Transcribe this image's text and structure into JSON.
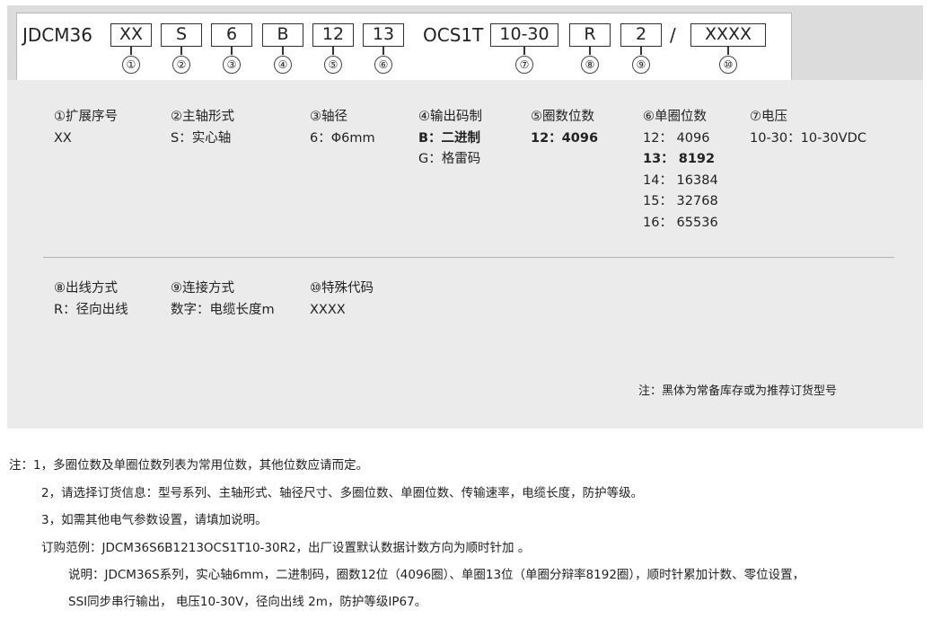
{
  "code": {
    "prefix": "JDCM36",
    "middle": "OCS1T",
    "slash": "/",
    "segments": [
      {
        "label": "XX",
        "num": "①"
      },
      {
        "label": "S",
        "num": "②"
      },
      {
        "label": "6",
        "num": "③"
      },
      {
        "label": "B",
        "num": "④"
      },
      {
        "label": "12",
        "num": "⑤"
      },
      {
        "label": "13",
        "num": "⑥"
      },
      {
        "label": "10-30",
        "num": "⑦"
      },
      {
        "label": "R",
        "num": "⑧"
      },
      {
        "label": "2",
        "num": "⑨"
      },
      {
        "label": "XXXX",
        "num": "⑩"
      }
    ]
  },
  "fields_row1": [
    {
      "header": "①扩展序号",
      "values": [
        {
          "text": "XX",
          "bold": false
        }
      ]
    },
    {
      "header": "②主轴形式",
      "values": [
        {
          "text": "S：实心轴",
          "bold": false
        }
      ]
    },
    {
      "header": "③轴径",
      "values": [
        {
          "text": "6：Φ6mm",
          "bold": false
        }
      ]
    },
    {
      "header": "④输出码制",
      "values": [
        {
          "text": "B：二进制",
          "bold": true
        },
        {
          "text": "G：格雷码",
          "bold": false
        }
      ]
    },
    {
      "header": "⑤圈数位数",
      "values": [
        {
          "text": "12：4096",
          "bold": true
        }
      ]
    },
    {
      "header": "⑥单圈位数",
      "values": [
        {
          "text": "12：  4096",
          "bold": false
        },
        {
          "text": "13：  8192",
          "bold": true
        },
        {
          "text": "14：  16384",
          "bold": false
        },
        {
          "text": "15：  32768",
          "bold": false
        },
        {
          "text": "16：  65536",
          "bold": false
        }
      ]
    },
    {
      "header": "⑦电压",
      "values": [
        {
          "text": "10-30：10-30VDC",
          "bold": false
        }
      ]
    }
  ],
  "fields_row2": [
    {
      "header": "⑧出线方式",
      "values": [
        {
          "text": "R：径向出线",
          "bold": false
        }
      ]
    },
    {
      "header": "⑨连接方式",
      "values": [
        {
          "text": "数字：电缆长度m",
          "bold": false
        }
      ]
    },
    {
      "header": "⑩特殊代码",
      "values": [
        {
          "text": "XXXX",
          "bold": false
        }
      ]
    }
  ],
  "panel_remark": "注：黑体为常备库存或为推荐订货型号",
  "notes": [
    "注：1，多圈位数及单圈位数列表为常用位数，其他位数应请而定。",
    "2，请选择订货信息：型号系列、主轴形式、轴径尺寸、多圈位数、单圈位数、传输速率，电缆长度，防护等级。",
    "3，如需其他电气参数设置，请填加说明。",
    "订购范例：JDCM36S6B1213OCS1T10-30R2，出厂设置默认数据计数方向为顺时针加 。",
    "说明：JDCM36S系列，实心轴6mm，二进制码，圈数12位（4096圈）、单圈13位（单圈分辩率8192圈），顺时针累加计数、零位设置，",
    "SSI同步串行输出， 电压10-30V，径向出线 2m，防护等级IP67。"
  ]
}
